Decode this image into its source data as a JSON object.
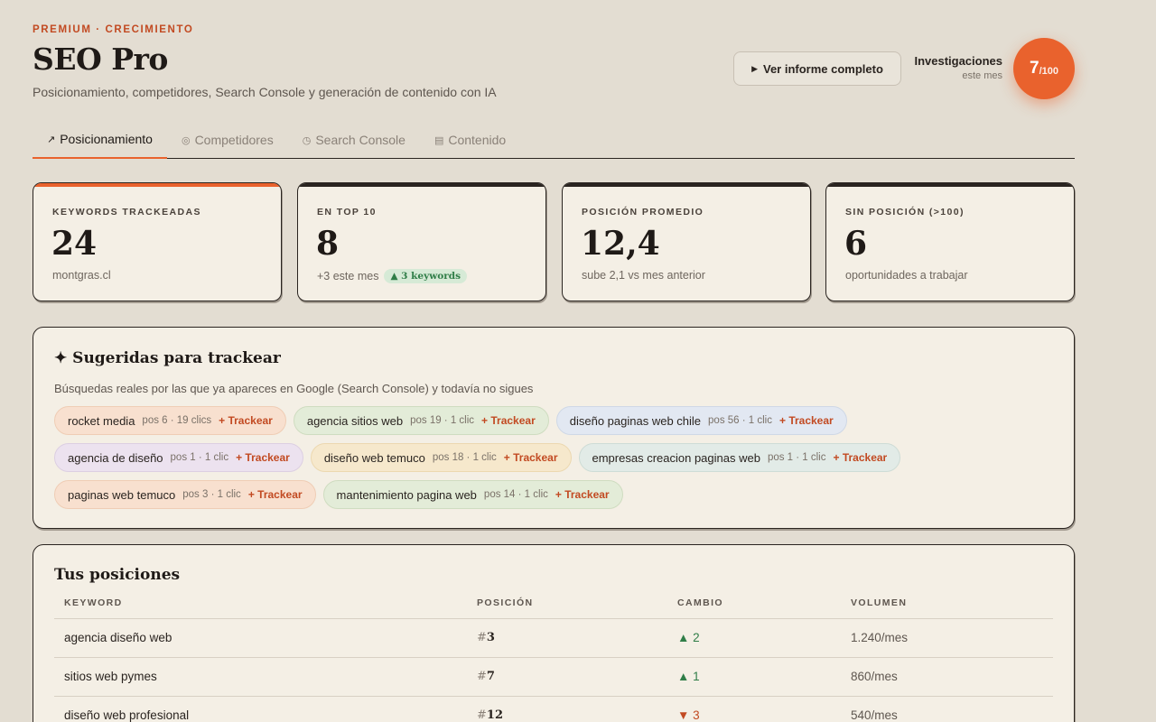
{
  "header": {
    "eyebrow": "PREMIUM · CRECIMIENTO",
    "title": "SEO Pro",
    "subtitle": "Posicionamiento, competidores, Search Console y generación de contenido con IA",
    "report_button": "Ver informe completo",
    "investigations_label": "Investigaciones",
    "investigations_sub": "este mes",
    "investigations_used": "7",
    "investigations_total": "/100"
  },
  "tabs": [
    {
      "icon": "↗",
      "label": "Posicionamiento",
      "active": true
    },
    {
      "icon": "◎",
      "label": "Competidores",
      "active": false
    },
    {
      "icon": "◷",
      "label": "Search Console",
      "active": false
    },
    {
      "icon": "▤",
      "label": "Contenido",
      "active": false
    }
  ],
  "stats": [
    {
      "label": "KEYWORDS TRACKEADAS",
      "value": "24",
      "foot": "montgras.cl",
      "accent": "#e9622d"
    },
    {
      "label": "EN TOP 10",
      "value": "8",
      "foot": "+3 este mes",
      "badge": "▲ 3 keywords"
    },
    {
      "label": "POSICIÓN PROMEDIO",
      "value": "12,4",
      "foot": "sube 2,1 vs mes anterior"
    },
    {
      "label": "SIN POSICIÓN (>100)",
      "value": "6",
      "foot": "oportunidades a trabajar"
    }
  ],
  "suggested": {
    "title": "✦ Sugeridas para trackear",
    "description": "Búsquedas reales por las que ya apareces en Google (Search Console) y todavía no sigues",
    "action_label": "+ Trackear",
    "chips": [
      {
        "keyword": "rocket media",
        "meta": "pos 6 · 19 clics",
        "color": "peach"
      },
      {
        "keyword": "agencia sitios web",
        "meta": "pos 19 · 1 clic",
        "color": "green"
      },
      {
        "keyword": "diseño paginas web chile",
        "meta": "pos 56 · 1 clic",
        "color": "blue"
      },
      {
        "keyword": "agencia de diseño",
        "meta": "pos 1 · 1 clic",
        "color": "lilac"
      },
      {
        "keyword": "diseño web temuco",
        "meta": "pos 18 · 1 clic",
        "color": "yellow"
      },
      {
        "keyword": "empresas creacion paginas web",
        "meta": "pos 1 · 1 clic",
        "color": "teal"
      },
      {
        "keyword": "paginas web temuco",
        "meta": "pos 3 · 1 clic",
        "color": "peach"
      },
      {
        "keyword": "mantenimiento pagina web",
        "meta": "pos 14 · 1 clic",
        "color": "green"
      }
    ]
  },
  "positions": {
    "title": "Tus posiciones",
    "columns": [
      "KEYWORD",
      "POSICIÓN",
      "CAMBIO",
      "VOLUMEN"
    ],
    "rows": [
      {
        "keyword": "agencia diseño web",
        "position": "3",
        "change": "▲ 2",
        "direction": "up",
        "volume": "1.240/mes"
      },
      {
        "keyword": "sitios web pymes",
        "position": "7",
        "change": "▲ 1",
        "direction": "up",
        "volume": "860/mes"
      },
      {
        "keyword": "diseño web profesional",
        "position": "12",
        "change": "▼ 3",
        "direction": "down",
        "volume": "540/mes"
      }
    ]
  }
}
